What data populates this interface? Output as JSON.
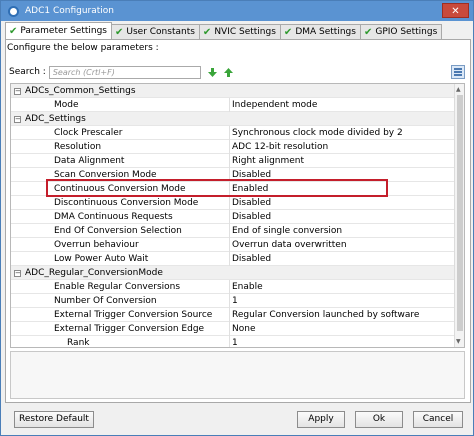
{
  "window": {
    "title": "ADC1 Configuration",
    "close_glyph": "✕"
  },
  "tabs": [
    {
      "label": "Parameter Settings",
      "active": true,
      "icon": "check-icon"
    },
    {
      "label": "User Constants",
      "active": false,
      "icon": "check-icon"
    },
    {
      "label": "NVIC Settings",
      "active": false,
      "icon": "check-icon"
    },
    {
      "label": "DMA Settings",
      "active": false,
      "icon": "check-icon"
    },
    {
      "label": "GPIO Settings",
      "active": false,
      "icon": "check-icon"
    }
  ],
  "config_label": "Configure the below parameters :",
  "search": {
    "label": "Search :",
    "placeholder": "Search (Crtl+F)"
  },
  "groups": [
    {
      "name": "ADCs_Common_Settings",
      "rows": [
        {
          "name": "Mode",
          "value": "Independent mode"
        }
      ]
    },
    {
      "name": "ADC_Settings",
      "rows": [
        {
          "name": "Clock Prescaler",
          "value": "Synchronous clock mode divided by 2"
        },
        {
          "name": "Resolution",
          "value": "ADC 12-bit resolution"
        },
        {
          "name": "Data Alignment",
          "value": "Right alignment"
        },
        {
          "name": "Scan Conversion Mode",
          "value": "Disabled"
        },
        {
          "name": "Continuous Conversion Mode",
          "value": "Enabled"
        },
        {
          "name": "Discontinuous Conversion Mode",
          "value": "Disabled"
        },
        {
          "name": "DMA Continuous Requests",
          "value": "Disabled"
        },
        {
          "name": "End Of Conversion Selection",
          "value": "End of single conversion"
        },
        {
          "name": "Overrun behaviour",
          "value": "Overrun data overwritten"
        },
        {
          "name": "Low Power Auto Wait",
          "value": "Disabled"
        }
      ]
    },
    {
      "name": "ADC_Regular_ConversionMode",
      "rows": [
        {
          "name": "Enable Regular Conversions",
          "value": "Enable"
        },
        {
          "name": "Number Of Conversion",
          "value": "1"
        },
        {
          "name": "External Trigger Conversion Source",
          "value": "Regular Conversion launched by software"
        },
        {
          "name": "External Trigger Conversion Edge",
          "value": "None"
        },
        {
          "name": "Rank",
          "value": "1"
        }
      ]
    }
  ],
  "highlighted_row": "Continuous Conversion Mode",
  "buttons": {
    "restore": "Restore Default",
    "apply": "Apply",
    "ok": "Ok",
    "cancel": "Cancel"
  },
  "colors": {
    "titlebar": "#5a93d2",
    "highlight": "#c41e2b",
    "check": "#2f9a2f"
  }
}
